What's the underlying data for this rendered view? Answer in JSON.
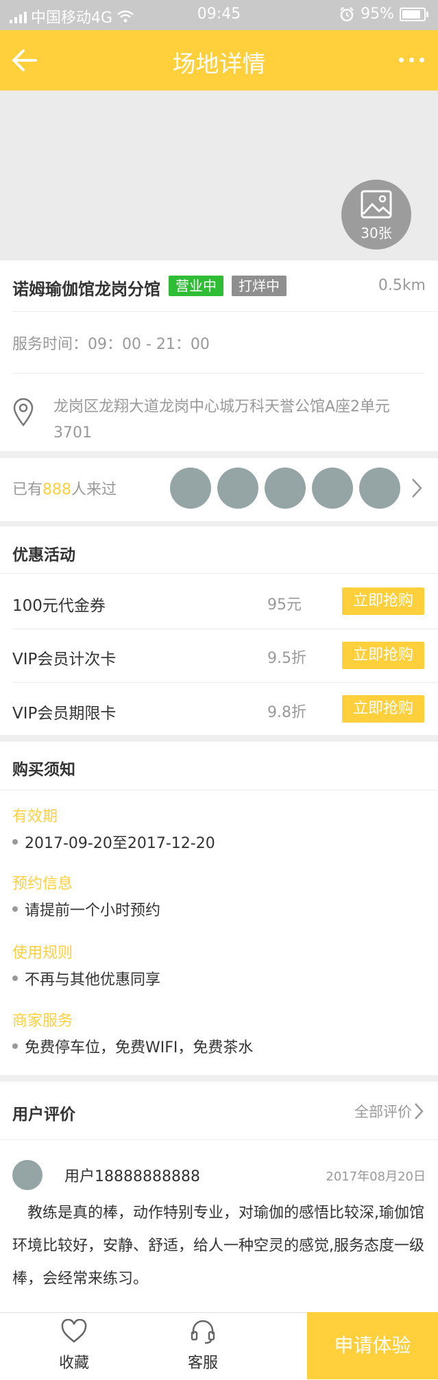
{
  "status_bar": {
    "carrier": "中国移动4G",
    "time": "09:45",
    "battery": "95%"
  },
  "header": {
    "title": "场地详情"
  },
  "banner": {
    "photo_count": "30张"
  },
  "venue": {
    "name": "诺姆瑜伽馆龙岗分馆",
    "tags": [
      {
        "label": "营业中",
        "color": "#2fbd35"
      },
      {
        "label": "打烊中",
        "color": "#8f8f8f"
      }
    ],
    "distance": "0.5km",
    "hours": "服务时间：09：00 - 21：00",
    "address": "龙岗区龙翔大道龙岗中心城万科天誉公馆A座2单元3701"
  },
  "visitors": {
    "prefix": "已有",
    "count": "888",
    "suffix": "人来过"
  },
  "promotions": {
    "title": "优惠活动",
    "items": [
      {
        "name": "100元代金券",
        "price": "95元",
        "button": "立即抢购"
      },
      {
        "name": "VIP会员计次卡",
        "price": "9.5折",
        "button": "立即抢购"
      },
      {
        "name": "VIP会员期限卡",
        "price": "9.8折",
        "button": "立即抢购"
      }
    ]
  },
  "notice": {
    "title": "购买须知",
    "sections": [
      {
        "title": "有效期",
        "item": "2017-09-20至2017-12-20"
      },
      {
        "title": "预约信息",
        "item": "请提前一个小时预约"
      },
      {
        "title": "使用规则",
        "item": "不再与其他优惠同享"
      },
      {
        "title": "商家服务",
        "item": "免费停车位，免费WIFI，免费茶水"
      }
    ]
  },
  "reviews": {
    "title": "用户评价",
    "all_label": "全部评价",
    "items": [
      {
        "user": "用户18888888888",
        "date": "2017年08月20日",
        "content": "教练是真的棒，动作特别专业，对瑜伽的感悟比较深,瑜伽馆环境比较好，安静、舒适，给人一种空灵的感觉,服务态度一级棒，会经常来练习。"
      }
    ]
  },
  "bottom_bar": {
    "favorite": "收藏",
    "service": "客服",
    "apply": "申请体验"
  },
  "colors": {
    "accent": "#ffcf3c",
    "open_tag": "#2fbd35",
    "closed_tag": "#8f8f8f"
  }
}
